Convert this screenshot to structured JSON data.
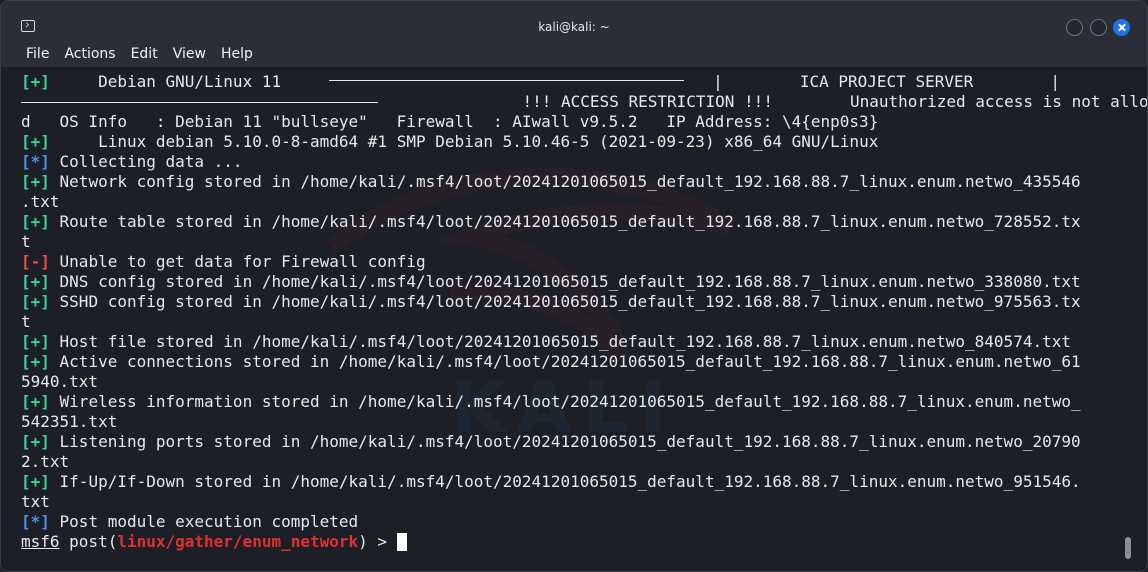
{
  "window": {
    "title": "kali@kali: ~"
  },
  "menubar": {
    "items": [
      "File",
      "Actions",
      "Edit",
      "View",
      "Help"
    ]
  },
  "terminal": {
    "tag_plus": "[+]",
    "tag_star": "[*]",
    "tag_minus": "[-]",
    "banner": {
      "line1_text": "     Debian GNU/Linux 11     ",
      "line1_sep": "   |        ",
      "line1_server": "ICA PROJECT SERVER        |",
      "line2_text": "               !!! ACCESS RESTRICTION !!!        Unauthorized access is not allowe",
      "line3_text": "d   OS Info   : Debian 11 \"bullseye\"   Firewall  : AIwall v9.5.2   IP Address: \\4{enp0s3}",
      "line4_text": "     Linux debian 5.10.0-8-amd64 #1 SMP Debian 5.10.46-5 (2021-09-23) x86_64 GNU/Linux"
    },
    "lines": [
      {
        "tag": "star",
        "text": " Collecting data ..."
      },
      {
        "tag": "plus",
        "text": " Network config stored in /home/kali/.msf4/loot/20241201065015_default_192.168.88.7_linux.enum.netwo_435546"
      },
      {
        "tag": "",
        "text": ".txt"
      },
      {
        "tag": "plus",
        "text": " Route table stored in /home/kali/.msf4/loot/20241201065015_default_192.168.88.7_linux.enum.netwo_728552.tx"
      },
      {
        "tag": "",
        "text": "t"
      },
      {
        "tag": "minus",
        "text": " Unable to get data for Firewall config"
      },
      {
        "tag": "plus",
        "text": " DNS config stored in /home/kali/.msf4/loot/20241201065015_default_192.168.88.7_linux.enum.netwo_338080.txt"
      },
      {
        "tag": "plus",
        "text": " SSHD config stored in /home/kali/.msf4/loot/20241201065015_default_192.168.88.7_linux.enum.netwo_975563.tx"
      },
      {
        "tag": "",
        "text": "t"
      },
      {
        "tag": "plus",
        "text": " Host file stored in /home/kali/.msf4/loot/20241201065015_default_192.168.88.7_linux.enum.netwo_840574.txt"
      },
      {
        "tag": "plus",
        "text": " Active connections stored in /home/kali/.msf4/loot/20241201065015_default_192.168.88.7_linux.enum.netwo_61"
      },
      {
        "tag": "",
        "text": "5940.txt"
      },
      {
        "tag": "plus",
        "text": " Wireless information stored in /home/kali/.msf4/loot/20241201065015_default_192.168.88.7_linux.enum.netwo_"
      },
      {
        "tag": "",
        "text": "542351.txt"
      },
      {
        "tag": "plus",
        "text": " Listening ports stored in /home/kali/.msf4/loot/20241201065015_default_192.168.88.7_linux.enum.netwo_20790"
      },
      {
        "tag": "",
        "text": "2.txt"
      },
      {
        "tag": "plus",
        "text": " If-Up/If-Down stored in /home/kali/.msf4/loot/20241201065015_default_192.168.88.7_linux.enum.netwo_951546."
      },
      {
        "tag": "",
        "text": "txt"
      },
      {
        "tag": "star",
        "text": " Post module execution completed"
      }
    ],
    "prompt": {
      "console": "msf6",
      "mid": " post(",
      "module": "linux/gather/enum_network",
      "end": ") > "
    }
  },
  "colors": {
    "plus": "#36d399",
    "star": "#4a8ff0",
    "minus": "#f04848",
    "module": "#e03030",
    "background": "#1c1f26"
  },
  "icons": {
    "app": "terminal-icon",
    "minimize": "minimize-button",
    "maximize": "maximize-button",
    "close": "close-icon"
  }
}
